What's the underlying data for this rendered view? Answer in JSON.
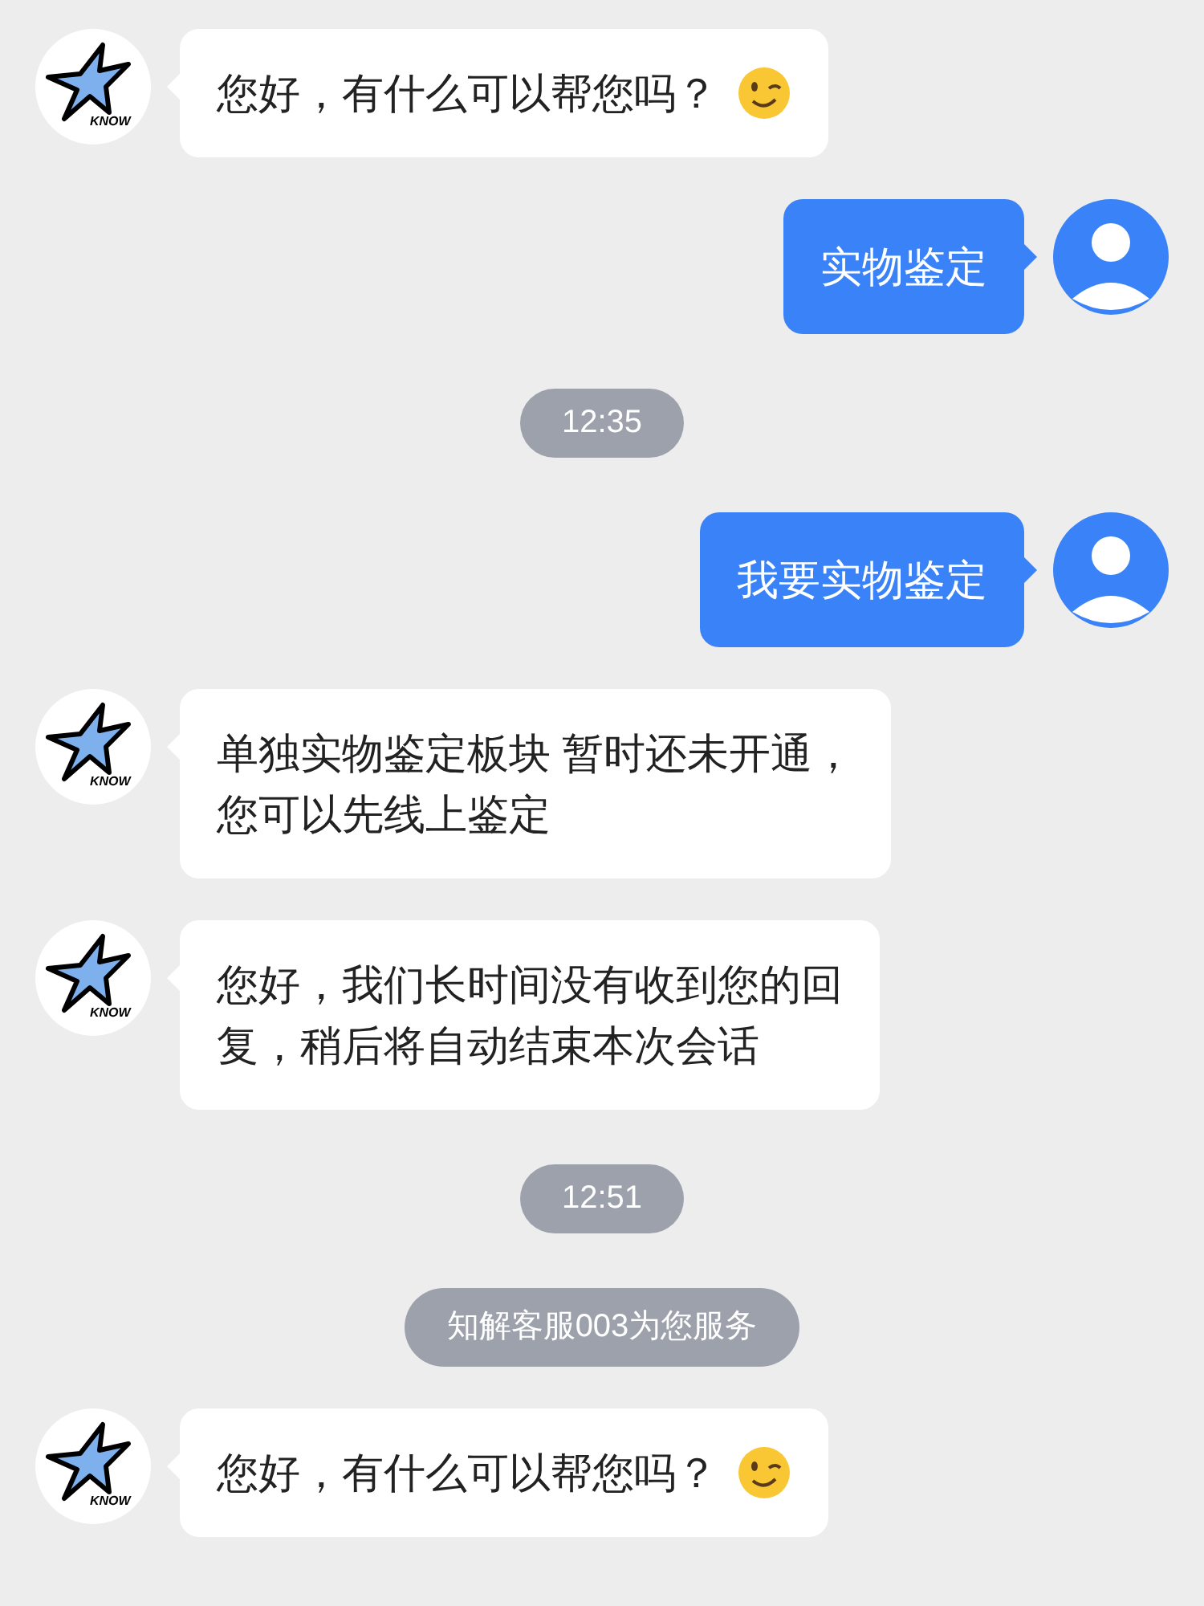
{
  "messages": [
    {
      "kind": "agent",
      "lines": [
        "您好，有什么可以帮您吗？"
      ],
      "emoji": true,
      "logo_text": "KNOW"
    },
    {
      "kind": "user",
      "text": "实物鉴定"
    },
    {
      "kind": "time",
      "text": "12:35"
    },
    {
      "kind": "user",
      "text": "我要实物鉴定"
    },
    {
      "kind": "agent",
      "lines": [
        "单独实物鉴定板块 暂时还未开通，",
        "您可以先线上鉴定"
      ],
      "emoji": false,
      "logo_text": "KNOW"
    },
    {
      "kind": "agent",
      "lines": [
        "您好，我们长时间没有收到您的回",
        "复，稍后将自动结束本次会话"
      ],
      "emoji": false,
      "logo_text": "KNOW"
    },
    {
      "kind": "time",
      "text": "12:51"
    },
    {
      "kind": "system",
      "text": "知解客服003为您服务"
    },
    {
      "kind": "agent",
      "lines": [
        "您好，有什么可以帮您吗？"
      ],
      "emoji": true,
      "logo_text": "KNOW"
    }
  ]
}
